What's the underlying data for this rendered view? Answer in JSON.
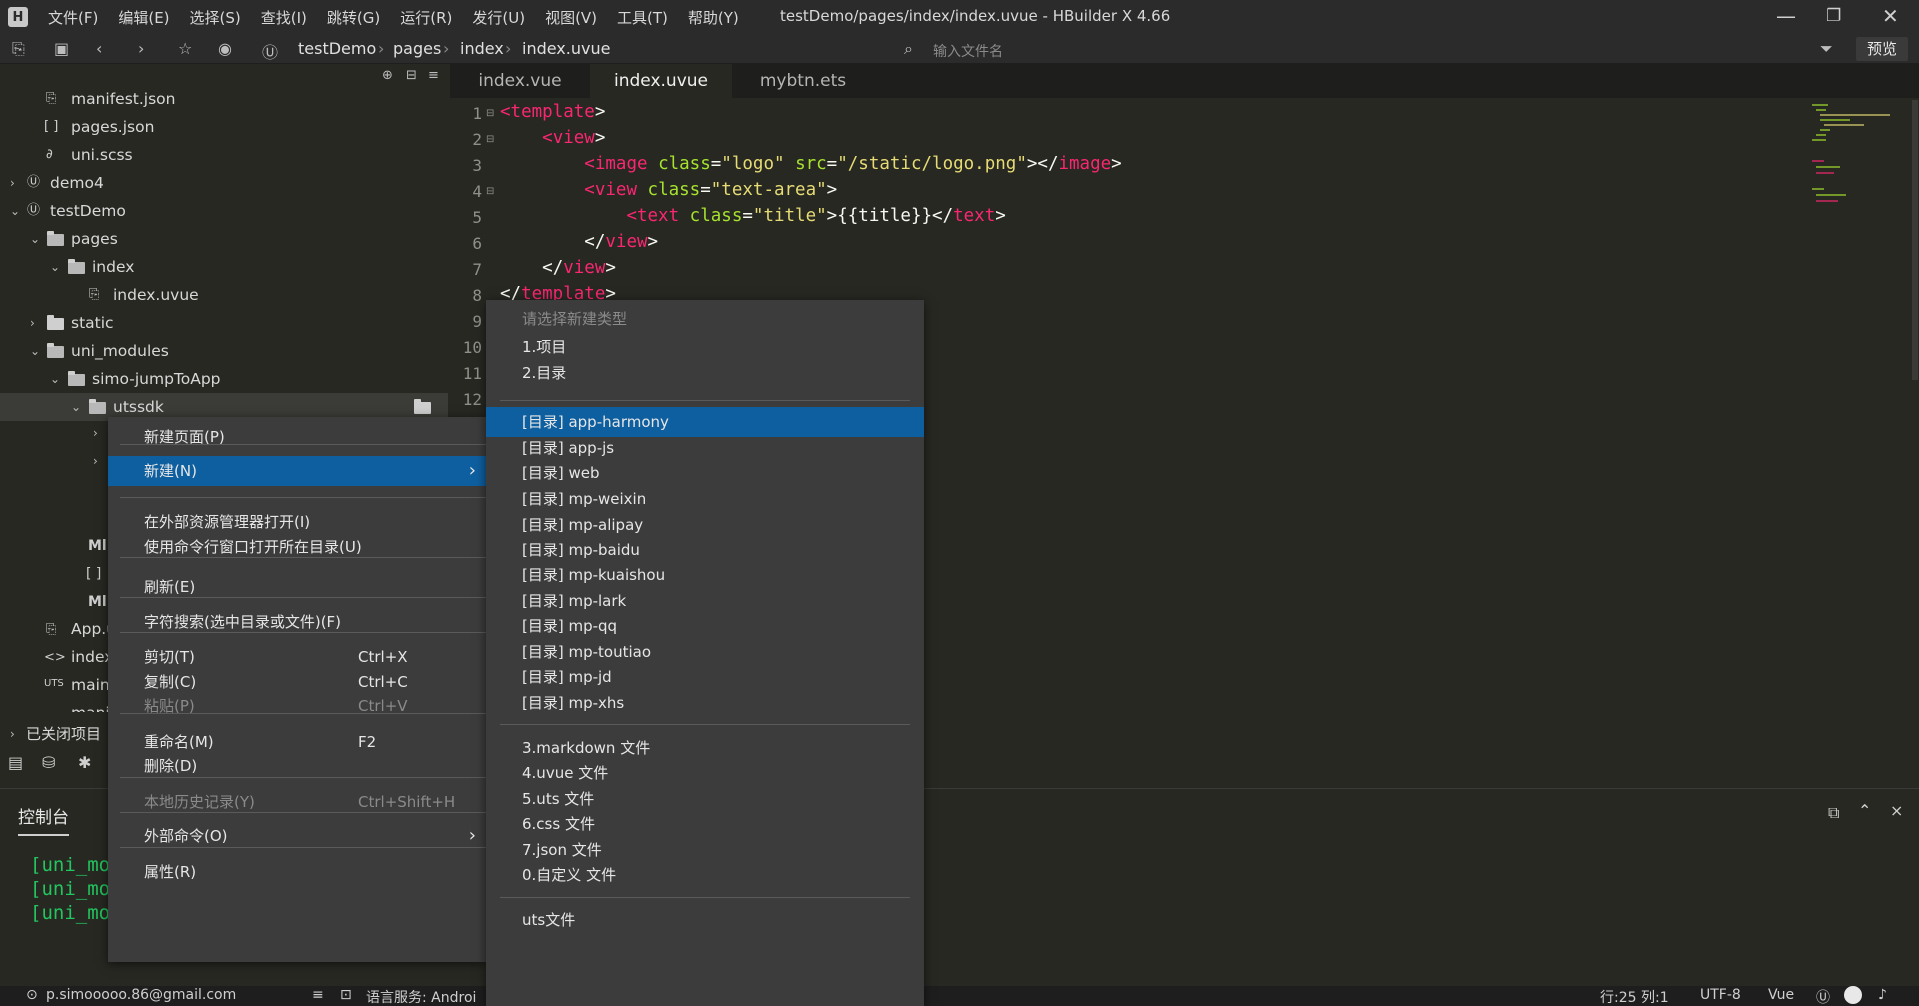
{
  "app": {
    "title": "testDemo/pages/index/index.uvue - HBuilder X 4.66",
    "menu": [
      "文件(F)",
      "编辑(E)",
      "选择(S)",
      "查找(I)",
      "跳转(G)",
      "运行(R)",
      "发行(U)",
      "视图(V)",
      "工具(T)",
      "帮助(Y)"
    ]
  },
  "toolbar": {
    "breadcrumb": [
      "testDemo",
      "pages",
      "index",
      "index.uvue"
    ],
    "search_placeholder": "输入文件名",
    "preview_label": "预览"
  },
  "sidebar": {
    "items": [
      {
        "label": "manifest.json",
        "type": "file",
        "icon": "json-file-icon"
      },
      {
        "label": "pages.json",
        "type": "file",
        "icon": "bracket-file-icon"
      },
      {
        "label": "uni.scss",
        "type": "file",
        "icon": "style-file-icon"
      },
      {
        "label": "demo4",
        "type": "project"
      },
      {
        "label": "testDemo",
        "type": "project"
      },
      {
        "label": "pages",
        "type": "folder"
      },
      {
        "label": "index",
        "type": "folder"
      },
      {
        "label": "index.uvue",
        "type": "file",
        "icon": "uvue-file-icon"
      },
      {
        "label": "static",
        "type": "folder"
      },
      {
        "label": "uni_modules",
        "type": "folder"
      },
      {
        "label": "simo-jumpToApp",
        "type": "folder"
      },
      {
        "label": "utssdk",
        "type": "folder"
      }
    ],
    "partial_rows": [
      "Ml",
      "[ ]",
      "Ml",
      "App.u",
      "index",
      "main.",
      "mani"
    ],
    "closed_projects": "已关闭项目"
  },
  "tabs": [
    {
      "label": "index.vue",
      "active": false
    },
    {
      "label": "index.uvue",
      "active": true
    },
    {
      "label": "mybtn.ets",
      "active": false
    }
  ],
  "editor": {
    "line_numbers": [
      "1",
      "2",
      "3",
      "4",
      "5",
      "6",
      "7",
      "8",
      "9",
      "10",
      "11",
      "12"
    ],
    "lines": [
      [
        {
          "t": "<",
          "c": "tag"
        },
        {
          "t": "template",
          "c": "tag"
        },
        {
          "t": ">",
          "c": "plain"
        }
      ],
      [
        {
          "t": "    ",
          "c": "plain"
        },
        {
          "t": "<",
          "c": "tag"
        },
        {
          "t": "view",
          "c": "tag"
        },
        {
          "t": ">",
          "c": "plain"
        }
      ],
      [
        {
          "t": "        ",
          "c": "plain"
        },
        {
          "t": "<image",
          "c": "tag"
        },
        {
          "t": " ",
          "c": "plain"
        },
        {
          "t": "class",
          "c": "attr"
        },
        {
          "t": "=",
          "c": "plain"
        },
        {
          "t": "\"logo\"",
          "c": "str"
        },
        {
          "t": " ",
          "c": "plain"
        },
        {
          "t": "src",
          "c": "attr"
        },
        {
          "t": "=",
          "c": "plain"
        },
        {
          "t": "\"/static/logo.png\"",
          "c": "str"
        },
        {
          "t": "></",
          "c": "plain"
        },
        {
          "t": "image",
          "c": "tag"
        },
        {
          "t": ">",
          "c": "plain"
        }
      ],
      [
        {
          "t": "        ",
          "c": "plain"
        },
        {
          "t": "<view",
          "c": "tag"
        },
        {
          "t": " ",
          "c": "plain"
        },
        {
          "t": "class",
          "c": "attr"
        },
        {
          "t": "=",
          "c": "plain"
        },
        {
          "t": "\"text-area\"",
          "c": "str"
        },
        {
          "t": ">",
          "c": "plain"
        }
      ],
      [
        {
          "t": "            ",
          "c": "plain"
        },
        {
          "t": "<text",
          "c": "tag"
        },
        {
          "t": " ",
          "c": "plain"
        },
        {
          "t": "class",
          "c": "attr"
        },
        {
          "t": "=",
          "c": "plain"
        },
        {
          "t": "\"title\"",
          "c": "str"
        },
        {
          "t": ">{{title}}</",
          "c": "plain"
        },
        {
          "t": "text",
          "c": "tag"
        },
        {
          "t": ">",
          "c": "plain"
        }
      ],
      [
        {
          "t": "        ",
          "c": "plain"
        },
        {
          "t": "</",
          "c": "plain"
        },
        {
          "t": "view",
          "c": "tag"
        },
        {
          "t": ">",
          "c": "plain"
        }
      ],
      [
        {
          "t": "    ",
          "c": "plain"
        },
        {
          "t": "</",
          "c": "plain"
        },
        {
          "t": "view",
          "c": "tag"
        },
        {
          "t": ">",
          "c": "plain"
        }
      ],
      [
        {
          "t": "</",
          "c": "plain"
        },
        {
          "t": "template",
          "c": "tag"
        },
        {
          "t": ">",
          "c": "plain"
        }
      ]
    ]
  },
  "console": {
    "tab_label": "控制台",
    "lines": [
      "[uni_mo",
      "[uni_mo",
      "[uni_mo"
    ]
  },
  "context_menu": {
    "items": [
      {
        "label": "新建页面(P)",
        "shortcut": "",
        "disabled": false,
        "highlight": false,
        "arrow": false
      },
      {
        "label": "新建(N)",
        "shortcut": "",
        "disabled": false,
        "highlight": true,
        "arrow": true
      },
      {
        "label": "在外部资源管理器打开(I)",
        "shortcut": "",
        "disabled": false,
        "highlight": false,
        "arrow": false
      },
      {
        "label": "使用命令行窗口打开所在目录(U)",
        "shortcut": "",
        "disabled": false,
        "highlight": false,
        "arrow": false
      },
      {
        "label": "刷新(E)",
        "shortcut": "",
        "disabled": false,
        "highlight": false,
        "arrow": false
      },
      {
        "label": "字符搜索(选中目录或文件)(F)",
        "shortcut": "",
        "disabled": false,
        "highlight": false,
        "arrow": false
      },
      {
        "label": "剪切(T)",
        "shortcut": "Ctrl+X",
        "disabled": false,
        "highlight": false,
        "arrow": false
      },
      {
        "label": "复制(C)",
        "shortcut": "Ctrl+C",
        "disabled": false,
        "highlight": false,
        "arrow": false
      },
      {
        "label": "粘贴(P)",
        "shortcut": "Ctrl+V",
        "disabled": true,
        "highlight": false,
        "arrow": false
      },
      {
        "label": "重命名(M)",
        "shortcut": "F2",
        "disabled": false,
        "highlight": false,
        "arrow": false
      },
      {
        "label": "删除(D)",
        "shortcut": "",
        "disabled": false,
        "highlight": false,
        "arrow": false
      },
      {
        "label": "本地历史记录(Y)",
        "shortcut": "Ctrl+Shift+H",
        "disabled": true,
        "highlight": false,
        "arrow": false
      },
      {
        "label": "外部命令(O)",
        "shortcut": "",
        "disabled": false,
        "highlight": false,
        "arrow": true
      },
      {
        "label": "属性(R)",
        "shortcut": "",
        "disabled": false,
        "highlight": false,
        "arrow": false
      }
    ]
  },
  "submenu": {
    "header": "请选择新建类型",
    "items": [
      {
        "label": "1.项目",
        "highlight": false
      },
      {
        "label": "2.目录",
        "highlight": false
      },
      {
        "label": "[目录] app-harmony",
        "highlight": true
      },
      {
        "label": "[目录] app-js",
        "highlight": false
      },
      {
        "label": "[目录] web",
        "highlight": false
      },
      {
        "label": "[目录] mp-weixin",
        "highlight": false
      },
      {
        "label": "[目录] mp-alipay",
        "highlight": false
      },
      {
        "label": "[目录] mp-baidu",
        "highlight": false
      },
      {
        "label": "[目录] mp-kuaishou",
        "highlight": false
      },
      {
        "label": "[目录] mp-lark",
        "highlight": false
      },
      {
        "label": "[目录] mp-qq",
        "highlight": false
      },
      {
        "label": "[目录] mp-toutiao",
        "highlight": false
      },
      {
        "label": "[目录] mp-jd",
        "highlight": false
      },
      {
        "label": "[目录] mp-xhs",
        "highlight": false
      },
      {
        "label": "3.markdown 文件",
        "highlight": false
      },
      {
        "label": "4.uvue 文件",
        "highlight": false
      },
      {
        "label": "5.uts 文件",
        "highlight": false
      },
      {
        "label": "6.css 文件",
        "highlight": false
      },
      {
        "label": "7.json 文件",
        "highlight": false
      },
      {
        "label": "0.自定义 文件",
        "highlight": false
      },
      {
        "label": "uts文件",
        "highlight": false
      }
    ]
  },
  "statusbar": {
    "user": "p.simooooo.86@gmail.com",
    "lang_service": "语言服务: Androi",
    "position": "行:25  列:1",
    "encoding": "UTF-8",
    "syntax": "Vue"
  },
  "colors": {
    "accent": "#0e5fa0",
    "tag": "#f92672",
    "attr": "#a6e22e",
    "string": "#e6db74",
    "console": "#22c55e"
  }
}
